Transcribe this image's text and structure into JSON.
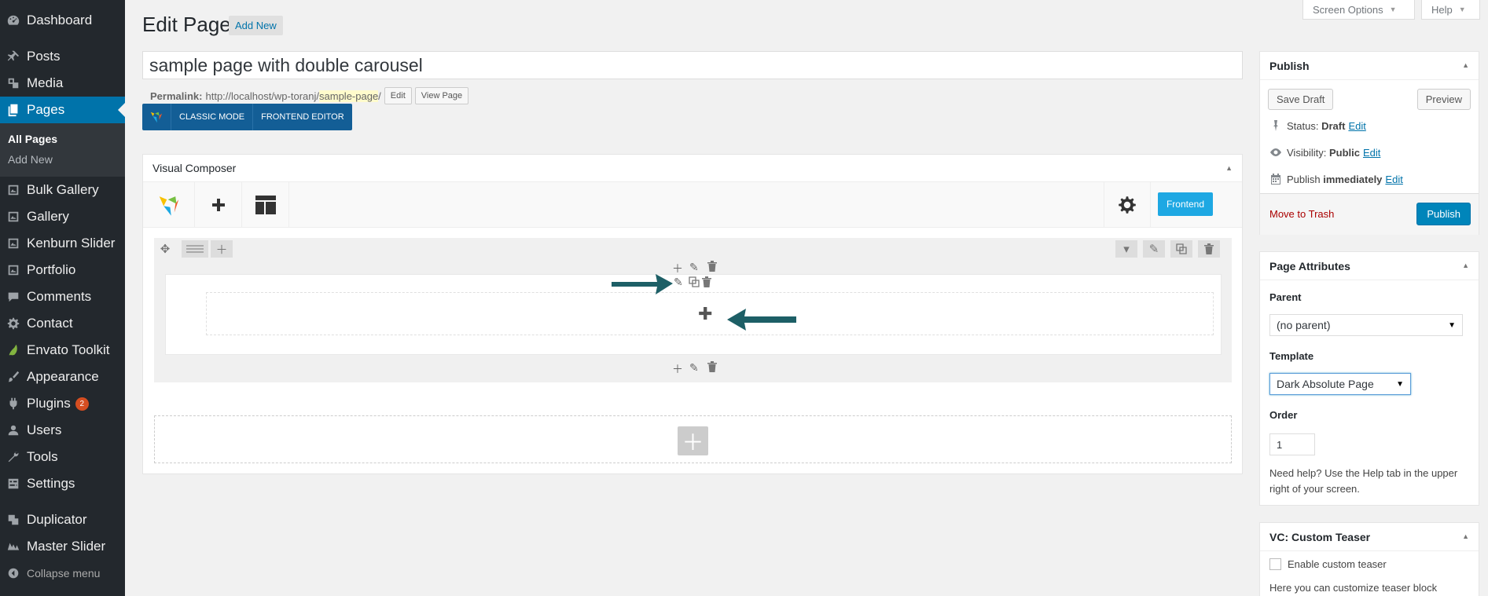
{
  "sidebar": {
    "items": [
      {
        "label": "Dashboard",
        "icon": "dashboard-icon"
      },
      {
        "label": "Posts",
        "icon": "pin-icon"
      },
      {
        "label": "Media",
        "icon": "media-icon"
      },
      {
        "label": "Pages",
        "icon": "pages-icon"
      },
      {
        "label": "Bulk Gallery",
        "icon": "gallery-icon"
      },
      {
        "label": "Gallery",
        "icon": "gallery-icon"
      },
      {
        "label": "Kenburn Slider",
        "icon": "gallery-icon"
      },
      {
        "label": "Portfolio",
        "icon": "gallery-icon"
      },
      {
        "label": "Comments",
        "icon": "comments-icon"
      },
      {
        "label": "Contact",
        "icon": "gear-icon"
      },
      {
        "label": "Envato Toolkit",
        "icon": "leaf-icon"
      },
      {
        "label": "Appearance",
        "icon": "brush-icon"
      },
      {
        "label": "Plugins",
        "icon": "plug-icon",
        "badge": "2"
      },
      {
        "label": "Users",
        "icon": "user-icon"
      },
      {
        "label": "Tools",
        "icon": "wrench-icon"
      },
      {
        "label": "Settings",
        "icon": "settings-icon"
      },
      {
        "label": "Duplicator",
        "icon": "duplicator-icon"
      },
      {
        "label": "Master Slider",
        "icon": "slider-icon"
      }
    ],
    "submenu": [
      "All Pages",
      "Add New"
    ],
    "collapse_label": "Collapse menu"
  },
  "top_tabs": {
    "screen_options": "Screen Options",
    "help": "Help"
  },
  "header": {
    "title": "Edit Page",
    "add_new": "Add New"
  },
  "post": {
    "title_value": "sample page with double carousel",
    "permalink_label": "Permalink:",
    "permalink_base": "http://localhost/wp-toranj/",
    "permalink_slug": "sample-page",
    "permalink_end": "/",
    "edit_btn": "Edit",
    "view_btn": "View Page"
  },
  "composer_switch": {
    "classic": "Classic Mode",
    "frontend": "Frontend Editor"
  },
  "visual_composer": {
    "title": "Visual Composer",
    "frontend_btn": "Frontend"
  },
  "publish": {
    "title": "Publish",
    "save_draft": "Save Draft",
    "preview": "Preview",
    "status_label": "Status:",
    "status_value": "Draft",
    "visibility_label": "Visibility:",
    "visibility_value": "Public",
    "publish_label": "Publish",
    "publish_value": "immediately",
    "edit": "Edit",
    "trash": "Move to Trash",
    "publish_btn": "Publish"
  },
  "page_attributes": {
    "title": "Page Attributes",
    "parent_label": "Parent",
    "parent_value": "(no parent)",
    "template_label": "Template",
    "template_value": "Dark Absolute Page",
    "order_label": "Order",
    "order_value": "1",
    "help": "Need help? Use the Help tab in the upper right of your screen."
  },
  "custom_teaser": {
    "title": "VC: Custom Teaser",
    "checkbox_label": "Enable custom teaser",
    "desc": "Here you can customize teaser block"
  },
  "colors": {
    "accent": "#0073aa",
    "sidebar": "#23282d",
    "annotation": "#1d5f66",
    "vc_frontend": "#1ea8e3"
  }
}
